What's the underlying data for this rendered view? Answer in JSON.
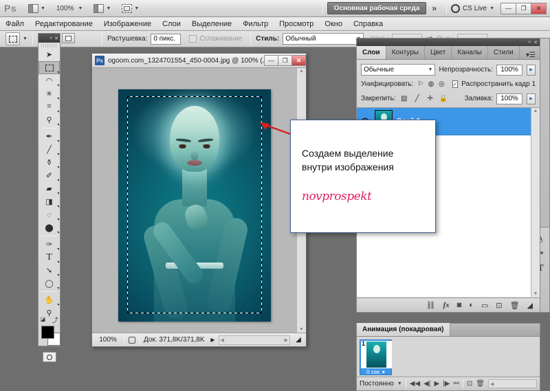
{
  "appbar": {
    "logo": "Ps",
    "arrange_icon": "arrange-documents-icon",
    "zoom_level": "100%",
    "screen_mode_icon": "screen-mode-icon",
    "view_extras_icon": "view-extras-icon",
    "workspace": "Основная рабочая среда",
    "more_chevron": "»",
    "cs_live": "CS Live",
    "window_buttons": {
      "minimize": "—",
      "restore": "❐",
      "close": "✕"
    }
  },
  "menubar": {
    "items": [
      "Файл",
      "Редактирование",
      "Изображение",
      "Слои",
      "Выделение",
      "Фильтр",
      "Просмотр",
      "Окно",
      "Справка"
    ]
  },
  "optionsbar": {
    "tool_icon": "rectangular-marquee-icon",
    "feather_label": "Растушевка:",
    "feather_value": "0 пикс.",
    "antialias_label": "Сглаживание",
    "style_label": "Стиль:",
    "style_value": "Обычный",
    "width_label": "Шир.:",
    "width_value": "",
    "swap_icon": "swap-dimensions-icon",
    "height_label": "Выс.:",
    "height_value": ""
  },
  "toolbox": {
    "collapse_icon": "«",
    "close_icon": "✕",
    "tools": [
      {
        "name": "move-tool",
        "glyph": "➤",
        "selected": false,
        "flyout": false
      },
      {
        "name": "rectangular-marquee-tool",
        "glyph": "▭",
        "selected": true,
        "flyout": true
      },
      {
        "name": "lasso-tool",
        "glyph": "✎",
        "selected": false,
        "flyout": true
      },
      {
        "name": "quick-selection-tool",
        "glyph": "✳",
        "selected": false,
        "flyout": true
      },
      {
        "name": "crop-tool",
        "glyph": "⌗",
        "selected": false,
        "flyout": true
      },
      {
        "name": "eyedropper-tool",
        "glyph": "⚲",
        "selected": false,
        "flyout": true
      },
      {
        "name": "spot-healing-brush-tool",
        "glyph": "✒",
        "selected": false,
        "flyout": true
      },
      {
        "name": "brush-tool",
        "glyph": "🖌",
        "selected": false,
        "flyout": true
      },
      {
        "name": "clone-stamp-tool",
        "glyph": "⚒",
        "selected": false,
        "flyout": true
      },
      {
        "name": "history-brush-tool",
        "glyph": "✐",
        "selected": false,
        "flyout": true
      },
      {
        "name": "eraser-tool",
        "glyph": "▰",
        "selected": false,
        "flyout": true
      },
      {
        "name": "gradient-tool",
        "glyph": "◨",
        "selected": false,
        "flyout": true
      },
      {
        "name": "blur-tool",
        "glyph": "◌",
        "selected": false,
        "flyout": true
      },
      {
        "name": "dodge-tool",
        "glyph": "⬤",
        "selected": false,
        "flyout": true
      },
      {
        "name": "pen-tool",
        "glyph": "✑",
        "selected": false,
        "flyout": true
      },
      {
        "name": "horizontal-type-tool",
        "glyph": "T",
        "selected": false,
        "flyout": true
      },
      {
        "name": "path-selection-tool",
        "glyph": "➚",
        "selected": false,
        "flyout": true
      },
      {
        "name": "ellipse-tool",
        "glyph": "◯",
        "selected": false,
        "flyout": true
      },
      {
        "name": "hand-tool",
        "glyph": "✋",
        "selected": false,
        "flyout": false
      },
      {
        "name": "zoom-tool",
        "glyph": "⚲",
        "selected": false,
        "flyout": false
      }
    ],
    "foreground_color": "#000000",
    "background_color": "#ffffff",
    "quickmask_icon": "quick-mask-icon"
  },
  "document": {
    "icon": "Ps",
    "title": "ogoom.com_1324701554_450-0004.jpg @ 100% (...",
    "buttons": {
      "minimize": "—",
      "maximize": "❐",
      "close": "✕"
    },
    "status": {
      "zoom": "100%",
      "thumb_icon": "doc-profile-icon",
      "doc_size": "Док: 371,8K/371,8K",
      "arrow": "▶"
    }
  },
  "callout": {
    "line1": "Создаем выделение",
    "line2": "внутри изображения",
    "signature": "novprospekt",
    "arrow_color": "#d81f1f",
    "border_color": "#3f5f8f"
  },
  "layers_panel": {
    "tabs": [
      "Слои",
      "Контуры",
      "Цвет",
      "Каналы",
      "Стили"
    ],
    "active_tab": "Слои",
    "menu_icon": "panel-menu-icon",
    "blend_mode": "Обычные",
    "opacity_label": "Непрозрачность:",
    "opacity_value": "100%",
    "unify_label": "Унифицировать:",
    "unify_icons": [
      "unify-position-icon",
      "unify-visibility-icon",
      "unify-style-icon"
    ],
    "propagate_label": "Распространить кадр 1",
    "propagate_checked": true,
    "lock_label": "Закрепить:",
    "lock_icons": [
      "lock-transparency-icon",
      "lock-image-icon",
      "lock-position-icon",
      "lock-all-icon"
    ],
    "fill_label": "Заливка:",
    "fill_value": "100%",
    "layers": [
      {
        "name": "Слой 0",
        "visible": true,
        "selected": true,
        "thumb": "layer-thumbnail"
      }
    ],
    "footer_icons": [
      "link-layers-icon",
      "layer-style-icon",
      "layer-mask-icon",
      "adjustment-layer-icon",
      "new-group-icon",
      "new-layer-icon",
      "delete-layer-icon"
    ],
    "selection_highlight": "#3d97e8"
  },
  "animation_panel": {
    "tab": "Анимация (покадровая)",
    "frames": [
      {
        "number": "1",
        "duration": "0 сек.",
        "selected": true
      }
    ],
    "loop_value": "Постоянно",
    "controls": [
      "select-first-frame-icon",
      "select-previous-frame-icon",
      "play-animation-icon",
      "select-next-frame-icon",
      "tween-icon",
      "duplicate-frame-icon",
      "delete-frame-icon"
    ]
  },
  "icon_dock": {
    "icons": [
      "character-panel-icon",
      "paragraph-panel-icon",
      "type-panel-icon"
    ]
  }
}
